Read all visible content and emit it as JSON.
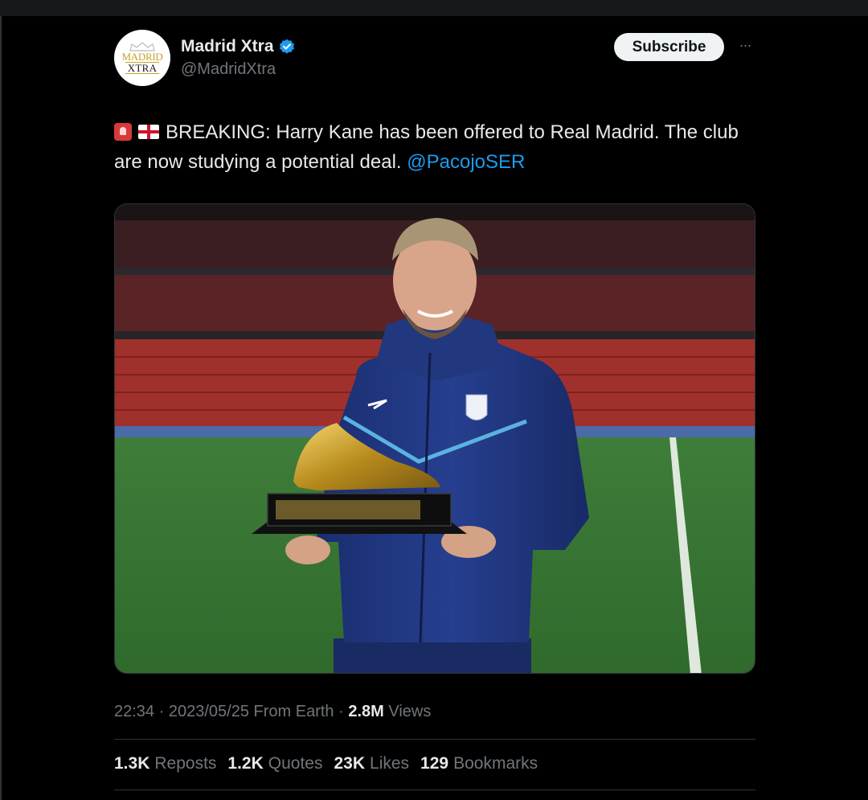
{
  "account": {
    "name": "Madrid Xtra",
    "handle": "@MadridXtra",
    "avatar_line1": "MADRID",
    "avatar_line2": "XTRA",
    "verified": true
  },
  "actions": {
    "subscribe_label": "Subscribe",
    "more_label": "···"
  },
  "tweet": {
    "text": "BREAKING: Harry Kane has been offered to Real Madrid. The club are now studying a potential deal.",
    "mention": "@PacojoSER",
    "emojis": [
      "rotating-light",
      "england-flag"
    ]
  },
  "meta": {
    "time": "22:34",
    "date": "2023/05/25",
    "source": "From Earth",
    "views_count": "2.8M",
    "views_label": "Views"
  },
  "stats": [
    {
      "count": "1.3K",
      "label": "Reposts"
    },
    {
      "count": "1.2K",
      "label": "Quotes"
    },
    {
      "count": "23K",
      "label": "Likes"
    },
    {
      "count": "129",
      "label": "Bookmarks"
    }
  ],
  "colors": {
    "background": "#000000",
    "text": "#e7e9ea",
    "muted": "#71767b",
    "link": "#1d9bf0",
    "verified": "#1d9bf0",
    "divider": "#2f3336"
  }
}
